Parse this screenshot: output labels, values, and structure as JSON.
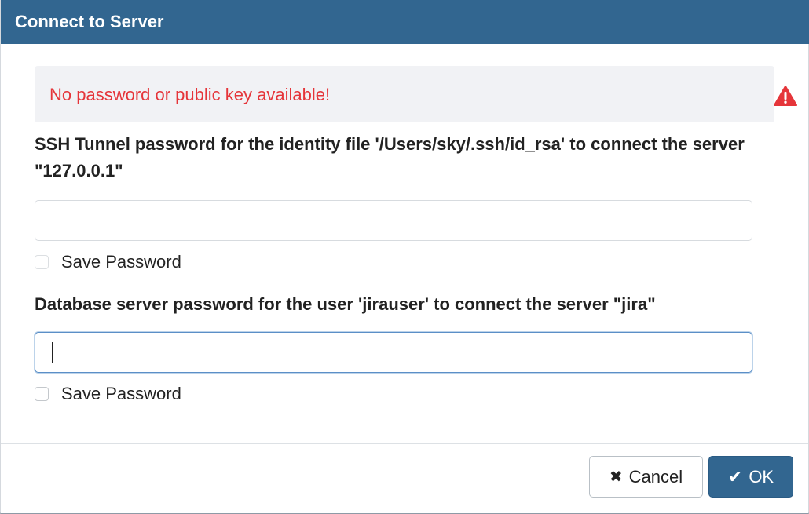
{
  "dialog": {
    "title": "Connect to Server"
  },
  "alert": {
    "message": "No password or public key available!",
    "icon": "warning-triangle-icon",
    "color": "#e5353a"
  },
  "ssh_tunnel": {
    "label": "SSH Tunnel password for the identity file '/Users/sky/.ssh/id_rsa' to connect the server \"127.0.0.1\"",
    "value": "",
    "save_password_label": "Save Password",
    "save_password_checked": false
  },
  "database": {
    "label": "Database server password for the user 'jirauser' to connect the server \"jira\"",
    "value": "",
    "save_password_label": "Save Password",
    "save_password_checked": false
  },
  "buttons": {
    "cancel_label": "Cancel",
    "cancel_icon": "close-icon",
    "ok_label": "OK",
    "ok_icon": "check-icon"
  },
  "colors": {
    "header": "#326690",
    "primary_button": "#326690",
    "alert_background": "#f1f2f5"
  }
}
